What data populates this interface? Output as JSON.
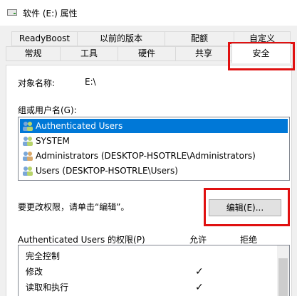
{
  "window": {
    "title": "软件 (E:) 属性",
    "icon": "drive-icon"
  },
  "tabs": {
    "row1": [
      "ReadyBoost",
      "以前的版本",
      "配额",
      "自定义"
    ],
    "row2": [
      "常规",
      "工具",
      "硬件",
      "共享",
      "安全"
    ],
    "active": "安全"
  },
  "security": {
    "object_label": "对象名称:",
    "object_value": "E:\\",
    "group_label": "组或用户名(G):",
    "users": [
      {
        "name": "Authenticated Users",
        "selected": true
      },
      {
        "name": "SYSTEM",
        "selected": false
      },
      {
        "name": "Administrators (DESKTOP-HSOTRLE\\Administrators)",
        "selected": false
      },
      {
        "name": "Users (DESKTOP-HSOTRLE\\Users)",
        "selected": false
      }
    ],
    "change_hint": "要更改权限，请单击“编辑”。",
    "edit_button": "编辑(E)...",
    "perm_header": "Authenticated Users 的权限(P)",
    "allow_header": "允许",
    "deny_header": "拒绝",
    "permissions": [
      {
        "name": "完全控制",
        "allow": "",
        "deny": ""
      },
      {
        "name": "修改",
        "allow": "✓",
        "deny": ""
      },
      {
        "name": "读取和执行",
        "allow": "✓",
        "deny": ""
      }
    ]
  },
  "colors": {
    "highlight": "#e01010",
    "selection": "#0078d7"
  }
}
